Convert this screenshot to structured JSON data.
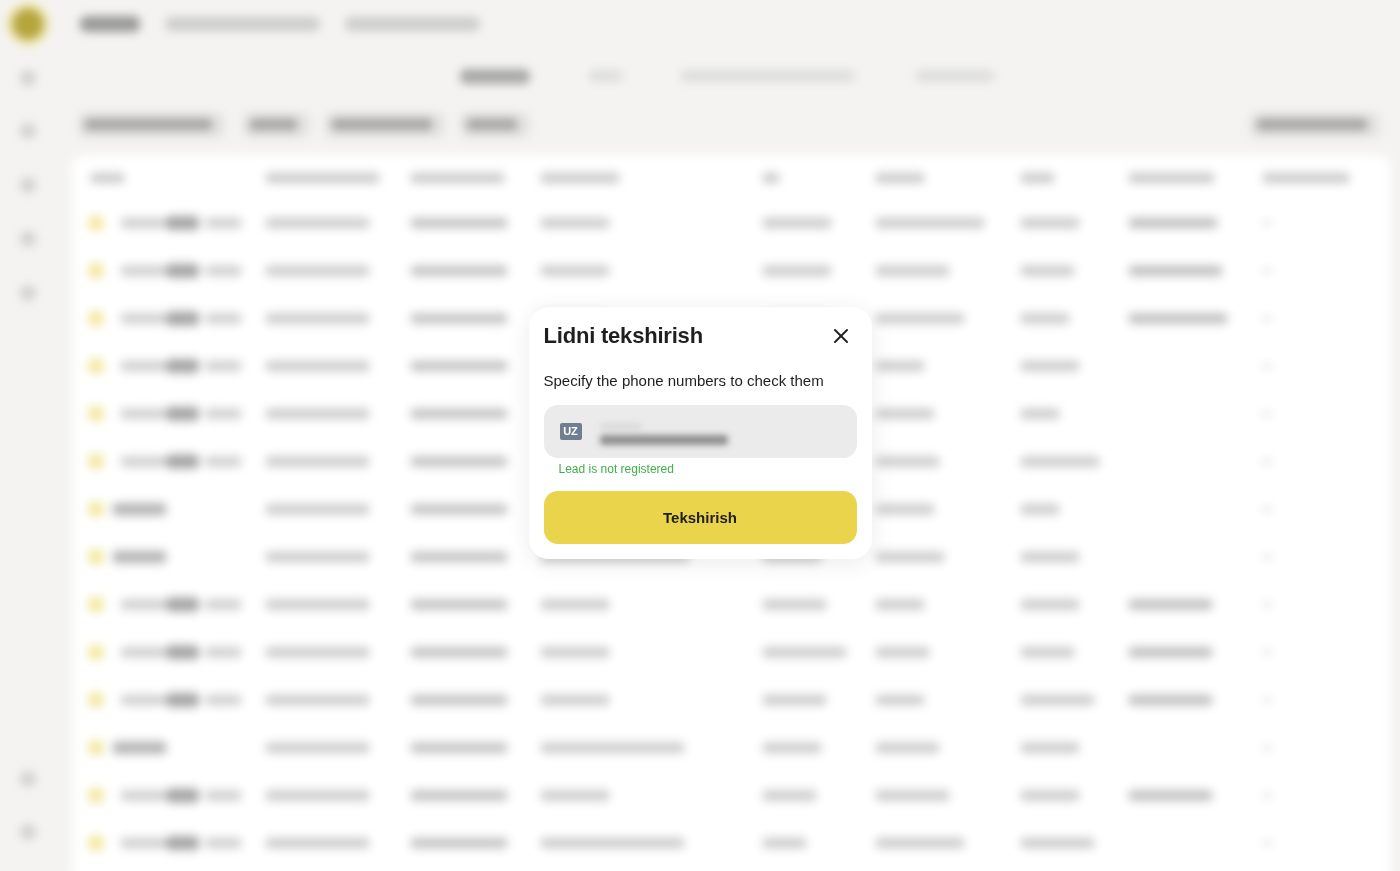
{
  "dialog": {
    "title": "Lidni tekshirish",
    "description": "Specify the phone numbers to check them",
    "phone_field": {
      "country_code": "UZ",
      "message": "Lead is not registered"
    },
    "submit_button": "Tekshirish"
  }
}
